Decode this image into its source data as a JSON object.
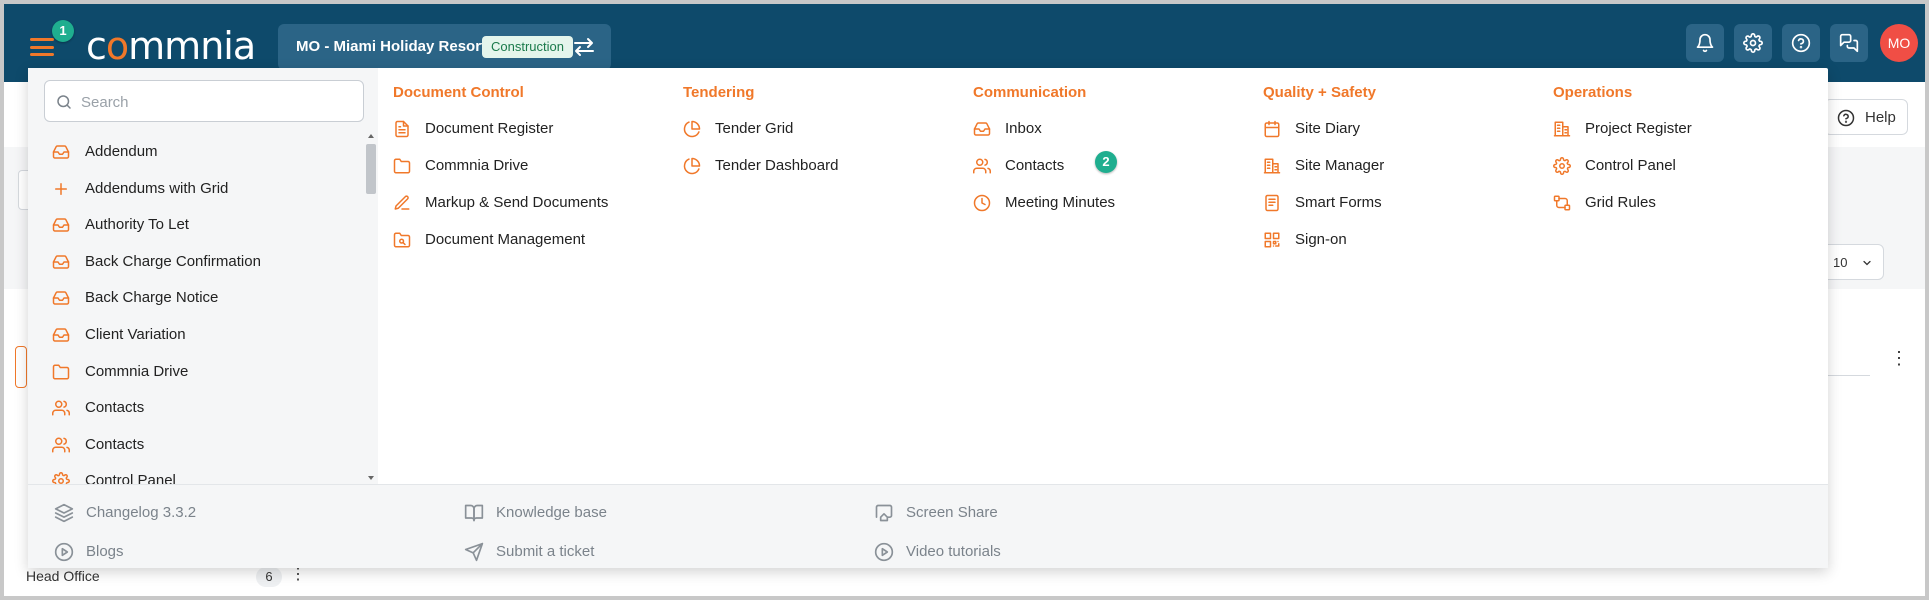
{
  "app": {
    "logo_text": "commnia",
    "hamburger_badge": "1",
    "project_name": "MO - Miami Holiday Resort",
    "project_tag": "Construction",
    "avatar_initials": "MO"
  },
  "colors": {
    "topbar": "#0e4a6b",
    "accent": "#f0782a",
    "badge": "#1fae8f",
    "avatar": "#f04e45"
  },
  "header_icons": [
    "bell-icon",
    "gear-icon",
    "help-circle-icon",
    "chat-icon"
  ],
  "background": {
    "help_label": "Help",
    "page_size_value": "10",
    "row_label": "Head Office",
    "row_count": "6"
  },
  "menu": {
    "search_placeholder": "Search",
    "list": [
      {
        "label": "Addendum",
        "icon": "inbox-icon"
      },
      {
        "label": "Addendums with Grid",
        "icon": "plus-icon"
      },
      {
        "label": "Authority To Let",
        "icon": "inbox-icon"
      },
      {
        "label": "Back Charge Confirmation",
        "icon": "inbox-icon"
      },
      {
        "label": "Back Charge Notice",
        "icon": "inbox-icon"
      },
      {
        "label": "Client Variation",
        "icon": "inbox-icon"
      },
      {
        "label": "Commnia Drive",
        "icon": "folder-icon"
      },
      {
        "label": "Contacts",
        "icon": "users-icon"
      },
      {
        "label": "Contacts",
        "icon": "users-icon"
      },
      {
        "label": "Control Panel",
        "icon": "gear-icon"
      }
    ],
    "columns": [
      {
        "heading": "Document Control",
        "items": [
          {
            "label": "Document Register",
            "icon": "document-icon"
          },
          {
            "label": "Commnia Drive",
            "icon": "folder-icon"
          },
          {
            "label": "Markup & Send Documents",
            "icon": "pen-icon"
          },
          {
            "label": "Document Management",
            "icon": "folder-search-icon"
          }
        ]
      },
      {
        "heading": "Tendering",
        "items": [
          {
            "label": "Tender Grid",
            "icon": "pie-chart-icon"
          },
          {
            "label": "Tender Dashboard",
            "icon": "pie-chart-icon"
          }
        ]
      },
      {
        "heading": "Communication",
        "items": [
          {
            "label": "Inbox",
            "icon": "inbox-icon"
          },
          {
            "label": "Contacts",
            "icon": "users-icon"
          },
          {
            "label": "Meeting Minutes",
            "icon": "clock-icon"
          }
        ]
      },
      {
        "heading": "Quality + Safety",
        "items": [
          {
            "label": "Site Diary",
            "icon": "calendar-icon"
          },
          {
            "label": "Site Manager",
            "icon": "building-icon"
          },
          {
            "label": "Smart Forms",
            "icon": "form-icon"
          },
          {
            "label": "Sign-on",
            "icon": "qr-code-icon"
          }
        ]
      },
      {
        "heading": "Operations",
        "items": [
          {
            "label": "Project Register",
            "icon": "building-icon"
          },
          {
            "label": "Control Panel",
            "icon": "gear-icon"
          },
          {
            "label": "Grid Rules",
            "icon": "flow-icon"
          }
        ]
      }
    ],
    "contacts_badge": "2",
    "footer": [
      {
        "label": "Changelog 3.3.2",
        "icon": "layers-icon"
      },
      {
        "label": "Knowledge base",
        "icon": "book-icon"
      },
      {
        "label": "Screen Share",
        "icon": "screen-share-icon"
      },
      {
        "label": "Blogs",
        "icon": "play-circle-icon"
      },
      {
        "label": "Submit a ticket",
        "icon": "send-icon"
      },
      {
        "label": "Video tutorials",
        "icon": "play-circle-icon"
      }
    ]
  }
}
